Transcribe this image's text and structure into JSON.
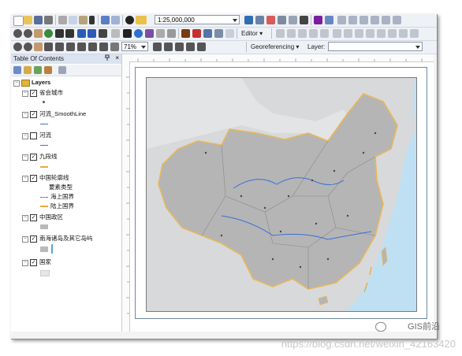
{
  "toolbar": {
    "scale": "1:25,000,000",
    "editor_label": "Editor",
    "zoom_percent": "71%",
    "georeferencing_label": "Georeferencing",
    "layer_label": "Layer:"
  },
  "toc": {
    "title": "Table Of Contents",
    "pin_glyph": "X",
    "close_glyph": "×",
    "root_label": "Layers",
    "layers": [
      {
        "label": "省会城市",
        "checked": true,
        "symbol": "dot"
      },
      {
        "label": "河流_SmoothLine",
        "checked": true,
        "symbol": "line-blue"
      },
      {
        "label": "河流",
        "checked": false,
        "symbol": "line-blue"
      },
      {
        "label": "九段线",
        "checked": true,
        "symbol": "line-orange"
      },
      {
        "label": "中国轮廓线",
        "checked": true,
        "symbol": "none"
      },
      {
        "label": "中国政区",
        "checked": true,
        "symbol": "fill-gray"
      },
      {
        "label": "南海诸岛及其它岛屿",
        "checked": true,
        "symbol": "fill-blue"
      },
      {
        "label": "国家",
        "checked": true,
        "symbol": "fill-light"
      }
    ],
    "sublegend": {
      "field": "要素类型",
      "items": [
        {
          "label": "海上国界",
          "symbol": "line-dash"
        },
        {
          "label": "陆上国界",
          "symbol": "line-orange"
        }
      ]
    }
  },
  "map": {
    "colors": {
      "sea": "#bfe0f2",
      "land": "#d9d9d9",
      "china": "#b5b5b5",
      "border": "#e8b85a",
      "river": "#3b6fd8"
    }
  },
  "watermark": {
    "brand": "GIS前沿",
    "url": "https://blog.csdn.net/weixin_42163420"
  }
}
